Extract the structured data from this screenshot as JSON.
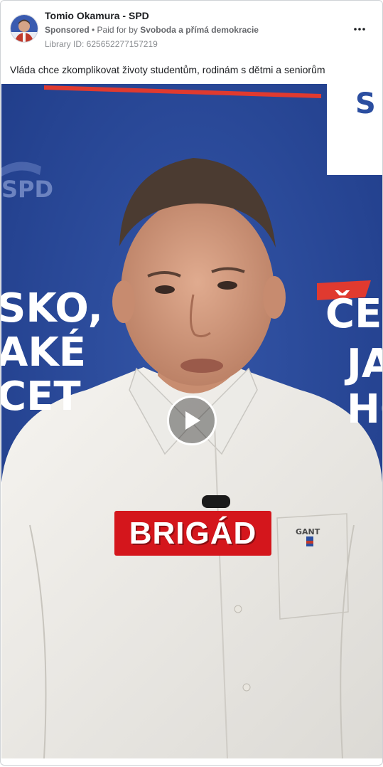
{
  "ad": {
    "page_name": "Tomio Okamura - SPD",
    "sponsored_label": "Sponsored",
    "paid_for_prefix": " • Paid for by ",
    "paid_for_by": "Svoboda a přímá demokracie",
    "library_id": "Library ID: 625652277157219",
    "caption": "Vláda chce zkomplikovat životy studentům, rodinám s dětmi a seniorům"
  },
  "video": {
    "subtitle": "BRIGÁD",
    "backdrop_text_left": [
      "SKO,",
      "AKÉ",
      "CET"
    ],
    "backdrop_text_right": [
      "ČE",
      "JA",
      "HC"
    ],
    "backdrop_logo_left": "SPD",
    "backdrop_logo_right": "S",
    "shirt_logo": "GANT"
  },
  "icons": {
    "more": "more-options-icon",
    "play": "play-icon"
  },
  "colors": {
    "backdrop_blue": "#2d4b9e",
    "subtitle_red": "#d4161c",
    "accent_red": "#e03a2f"
  }
}
